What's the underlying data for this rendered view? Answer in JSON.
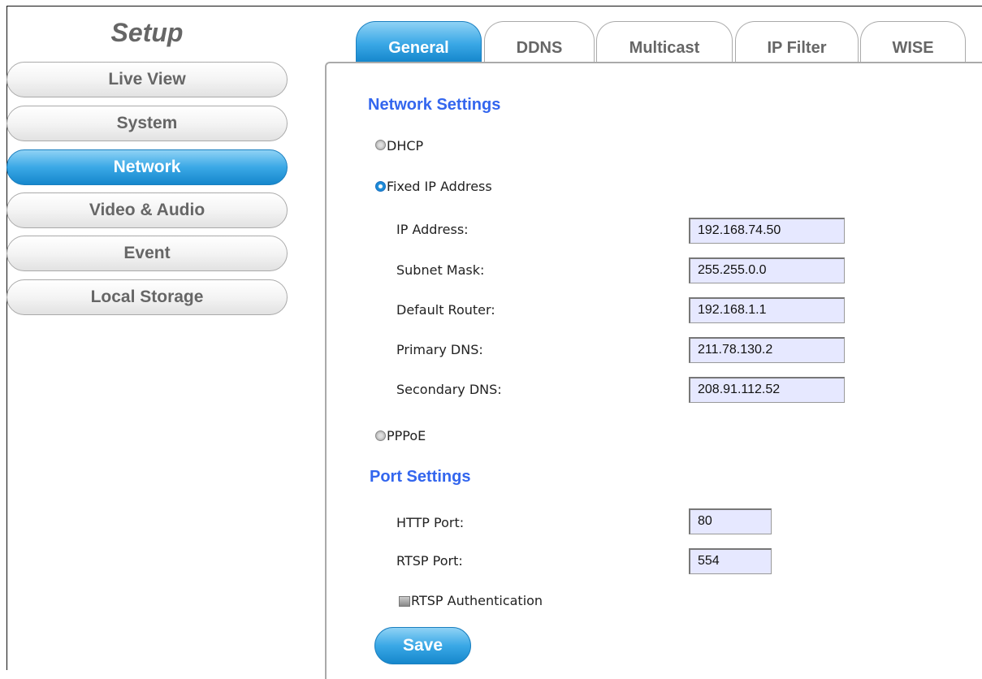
{
  "sidebar": {
    "title": "Setup",
    "items": [
      {
        "label": "Live View"
      },
      {
        "label": "System"
      },
      {
        "label": "Network",
        "active": true
      },
      {
        "label": "Video & Audio"
      },
      {
        "label": "Event"
      },
      {
        "label": "Local Storage"
      }
    ]
  },
  "tabs": [
    {
      "label": "General",
      "active": true
    },
    {
      "label": "DDNS"
    },
    {
      "label": "Multicast"
    },
    {
      "label": "IP Filter"
    },
    {
      "label": "WISE"
    }
  ],
  "network": {
    "title": "Network Settings",
    "dhcp_label": "DHCP",
    "fixed_label": "Fixed IP Address",
    "pppoe_label": "PPPoE",
    "selected_mode": "Fixed IP Address",
    "fields": [
      {
        "label": "IP Address:",
        "value": "192.168.74.50"
      },
      {
        "label": "Subnet Mask:",
        "value": "255.255.0.0"
      },
      {
        "label": "Default Router:",
        "value": "192.168.1.1"
      },
      {
        "label": "Primary DNS:",
        "value": "211.78.130.2"
      },
      {
        "label": "Secondary DNS:",
        "value": "208.91.112.52"
      }
    ]
  },
  "port": {
    "title": "Port Settings",
    "http_label": "HTTP Port:",
    "http_value": "80",
    "rtsp_label": "RTSP Port:",
    "rtsp_value": "554",
    "rtsp_auth_label": "RTSP Authentication",
    "rtsp_auth_checked": false
  },
  "save_label": "Save",
  "colors": {
    "accent_blue": "#2a9be0",
    "section_title": "#3366ee",
    "input_bg": "#e6e8ff"
  }
}
